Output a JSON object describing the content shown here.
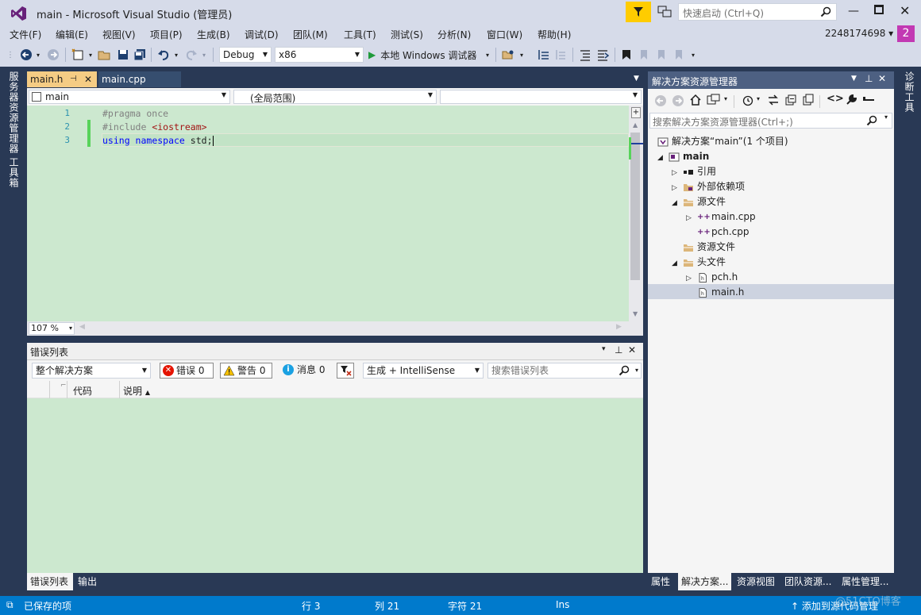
{
  "titlebar": {
    "title": "main - Microsoft Visual Studio (管理员)",
    "quick_launch_placeholder": "快速启动 (Ctrl+Q)",
    "notification_count": "2",
    "user_label": "2248174698",
    "logo_icon": "visual-studio-logo",
    "accent_color": "#68217a"
  },
  "menu": {
    "items": [
      "文件(F)",
      "编辑(E)",
      "视图(V)",
      "项目(P)",
      "生成(B)",
      "调试(D)",
      "团队(M)",
      "工具(T)",
      "测试(S)",
      "分析(N)",
      "窗口(W)",
      "帮助(H)"
    ]
  },
  "toolbar": {
    "config": "Debug",
    "platform": "x86",
    "run_label": "本地 Windows 调试器",
    "run_color": "#1e9a3a"
  },
  "left_rail": {
    "server_explorer": "服务器资源管理器",
    "toolbox": "工具箱"
  },
  "right_rail": {
    "diagnostics": "诊断工具"
  },
  "editor": {
    "tabs": [
      {
        "label": "main.h",
        "active": true
      },
      {
        "label": "main.cpp",
        "active": false
      }
    ],
    "nav": {
      "project": "main",
      "scope": "(全局范围)",
      "member": ""
    },
    "lines": [
      {
        "num": "1",
        "text": "#pragma once"
      },
      {
        "num": "2",
        "text": "#include <iostream>"
      },
      {
        "num": "3",
        "text": "using namespace std;"
      }
    ],
    "zoom": "107 %",
    "background_color": "#cce8cf"
  },
  "error_list": {
    "title": "错误列表",
    "scope": "整个解决方案",
    "errors": "错误 0",
    "warnings": "警告 0",
    "messages": "消息 0",
    "build_filter": "生成 + IntelliSense",
    "search_placeholder": "搜索错误列表",
    "columns": [
      "代码",
      "说明"
    ]
  },
  "bottom_tabs": [
    "错误列表",
    "输出"
  ],
  "solution_explorer": {
    "title": "解决方案资源管理器",
    "search_placeholder": "搜索解决方案资源管理器(Ctrl+;)",
    "tree": [
      {
        "label": "解决方案“main”(1 个项目)",
        "level": 0,
        "expander": "",
        "icon": "solution-icon"
      },
      {
        "label": "main",
        "level": 0,
        "expander": "◢",
        "icon": "cpp-project-icon",
        "bold": true
      },
      {
        "label": "引用",
        "level": 1,
        "expander": "▷",
        "icon": "references-icon"
      },
      {
        "label": "外部依赖项",
        "level": 1,
        "expander": "▷",
        "icon": "external-deps-icon"
      },
      {
        "label": "源文件",
        "level": 1,
        "expander": "◢",
        "icon": "folder-filter-icon"
      },
      {
        "label": "main.cpp",
        "level": 2,
        "expander": "▷",
        "icon": "cpp-file-icon"
      },
      {
        "label": "pch.cpp",
        "level": 2,
        "expander": "",
        "icon": "cpp-file-icon"
      },
      {
        "label": "资源文件",
        "level": 1,
        "expander": "",
        "icon": "folder-filter-icon"
      },
      {
        "label": "头文件",
        "level": 1,
        "expander": "◢",
        "icon": "folder-filter-icon"
      },
      {
        "label": "pch.h",
        "level": 2,
        "expander": "▷",
        "icon": "header-file-icon"
      },
      {
        "label": "main.h",
        "level": 2,
        "expander": "",
        "icon": "header-file-icon",
        "selected": true
      }
    ],
    "bottom_tabs": [
      "属性",
      "解决方案...",
      "资源视图",
      "团队资源...",
      "属性管理..."
    ]
  },
  "statusbar": {
    "saved": "已保存的项",
    "line": "行 3",
    "col": "列 21",
    "char": "字符 21",
    "mode": "Ins",
    "source_control": "添加到源代码管理",
    "watermark": "@51CTO博客",
    "background_color": "#007acc"
  }
}
